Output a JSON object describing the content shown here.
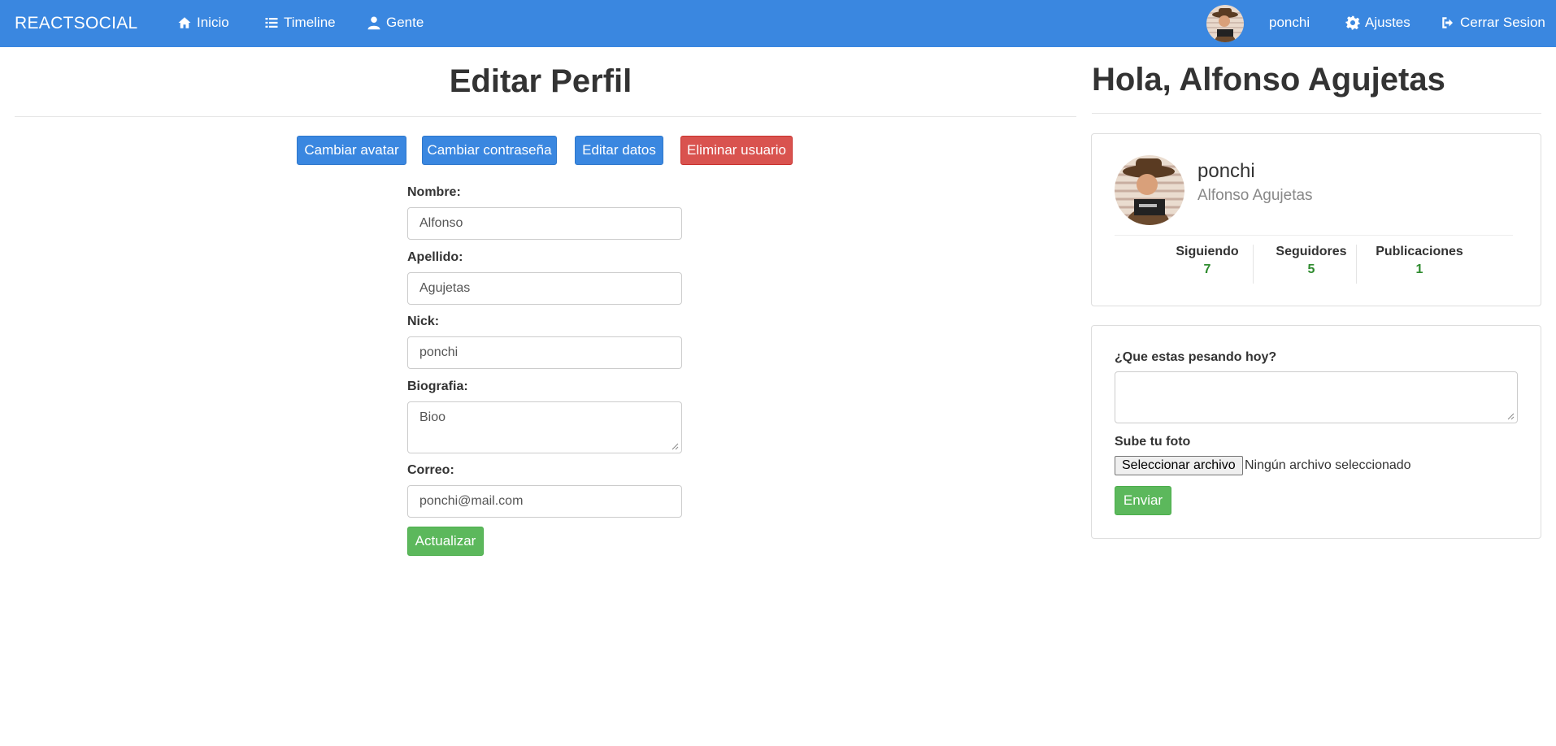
{
  "navbar": {
    "brand": "REACTSOCIAL",
    "links": [
      {
        "label": "Inicio",
        "icon": "home-icon"
      },
      {
        "label": "Timeline",
        "icon": "list-icon"
      },
      {
        "label": "Gente",
        "icon": "user-icon"
      }
    ],
    "user_nick": "ponchi",
    "settings_label": "Ajustes",
    "logout_label": "Cerrar Sesion",
    "bg_color": "#3a87e0"
  },
  "edit_profile": {
    "title": "Editar Perfil",
    "tabs": [
      {
        "label": "Cambiar avatar",
        "color": "#3a87e0"
      },
      {
        "label": "Cambiar contraseña",
        "color": "#3a87e0"
      },
      {
        "label": "Editar datos",
        "color": "#3a87e0"
      },
      {
        "label": "Eliminar usuario",
        "color": "#d9534f"
      }
    ],
    "fields": {
      "name_label": "Nombre:",
      "name_value": "Alfonso",
      "surname_label": "Apellido:",
      "surname_value": "Agujetas",
      "nick_label": "Nick:",
      "nick_value": "ponchi",
      "bio_label": "Biografia:",
      "bio_value": "Bioo",
      "email_label": "Correo:",
      "email_value": "ponchi@mail.com"
    },
    "submit_label": "Actualizar"
  },
  "sidebar": {
    "greeting": "Hola, Alfonso Agujetas",
    "profile": {
      "nick": "ponchi",
      "full_name": "Alfonso Agujetas",
      "stats": [
        {
          "label": "Siguiendo",
          "value": "7"
        },
        {
          "label": "Seguidores",
          "value": "5"
        },
        {
          "label": "Publicaciones",
          "value": "1"
        }
      ]
    },
    "post_form": {
      "text_label": "¿Que estas pesando hoy?",
      "photo_label": "Sube tu foto",
      "file_button": "Seleccionar archivo",
      "file_status": "Ningún archivo seleccionado",
      "submit_label": "Enviar"
    }
  }
}
